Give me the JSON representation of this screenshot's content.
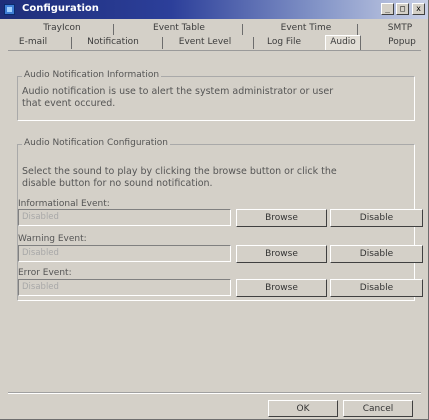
{
  "window": {
    "title": "Configuration",
    "controls": {
      "minimize": "_",
      "maximize": "□",
      "close": "x"
    }
  },
  "tabs": {
    "row1": [
      "TrayIcon",
      "Event Table",
      "Event Time",
      "SMTP"
    ],
    "row2": [
      "E-mail",
      "Notification",
      "Event Level",
      "Log File",
      "Audio",
      "Popup"
    ],
    "active": "Audio"
  },
  "info_group": {
    "title": "Audio Notification Information",
    "text_line1": "Audio notification is use to alert the system administrator or user",
    "text_line2": "that event occured."
  },
  "config_group": {
    "title": "Audio Notification Configuration",
    "text_line1": "Select the sound to play by clicking the browse button or click the",
    "text_line2": "disable button for no sound notification.",
    "events": [
      {
        "label": "Informational Event:",
        "value": "Disabled",
        "browse": "Browse",
        "disable": "Disable"
      },
      {
        "label": "Warning Event:",
        "value": "Disabled",
        "browse": "Browse",
        "disable": "Disable"
      },
      {
        "label": "Error Event:",
        "value": "Disabled",
        "browse": "Browse",
        "disable": "Disable"
      }
    ]
  },
  "footer": {
    "ok": "OK",
    "cancel": "Cancel"
  }
}
